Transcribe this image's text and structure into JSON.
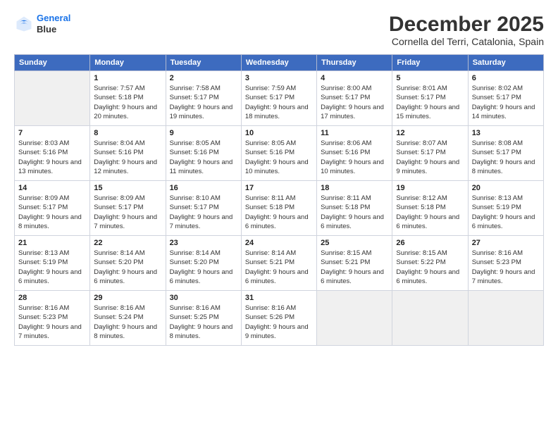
{
  "logo": {
    "line1": "General",
    "line2": "Blue"
  },
  "header": {
    "month": "December 2025",
    "location": "Cornella del Terri, Catalonia, Spain"
  },
  "weekdays": [
    "Sunday",
    "Monday",
    "Tuesday",
    "Wednesday",
    "Thursday",
    "Friday",
    "Saturday"
  ],
  "weeks": [
    [
      {
        "day": "",
        "sunrise": "",
        "sunset": "",
        "daylight": ""
      },
      {
        "day": "1",
        "sunrise": "Sunrise: 7:57 AM",
        "sunset": "Sunset: 5:18 PM",
        "daylight": "Daylight: 9 hours and 20 minutes."
      },
      {
        "day": "2",
        "sunrise": "Sunrise: 7:58 AM",
        "sunset": "Sunset: 5:17 PM",
        "daylight": "Daylight: 9 hours and 19 minutes."
      },
      {
        "day": "3",
        "sunrise": "Sunrise: 7:59 AM",
        "sunset": "Sunset: 5:17 PM",
        "daylight": "Daylight: 9 hours and 18 minutes."
      },
      {
        "day": "4",
        "sunrise": "Sunrise: 8:00 AM",
        "sunset": "Sunset: 5:17 PM",
        "daylight": "Daylight: 9 hours and 17 minutes."
      },
      {
        "day": "5",
        "sunrise": "Sunrise: 8:01 AM",
        "sunset": "Sunset: 5:17 PM",
        "daylight": "Daylight: 9 hours and 15 minutes."
      },
      {
        "day": "6",
        "sunrise": "Sunrise: 8:02 AM",
        "sunset": "Sunset: 5:17 PM",
        "daylight": "Daylight: 9 hours and 14 minutes."
      }
    ],
    [
      {
        "day": "7",
        "sunrise": "Sunrise: 8:03 AM",
        "sunset": "Sunset: 5:16 PM",
        "daylight": "Daylight: 9 hours and 13 minutes."
      },
      {
        "day": "8",
        "sunrise": "Sunrise: 8:04 AM",
        "sunset": "Sunset: 5:16 PM",
        "daylight": "Daylight: 9 hours and 12 minutes."
      },
      {
        "day": "9",
        "sunrise": "Sunrise: 8:05 AM",
        "sunset": "Sunset: 5:16 PM",
        "daylight": "Daylight: 9 hours and 11 minutes."
      },
      {
        "day": "10",
        "sunrise": "Sunrise: 8:05 AM",
        "sunset": "Sunset: 5:16 PM",
        "daylight": "Daylight: 9 hours and 10 minutes."
      },
      {
        "day": "11",
        "sunrise": "Sunrise: 8:06 AM",
        "sunset": "Sunset: 5:16 PM",
        "daylight": "Daylight: 9 hours and 10 minutes."
      },
      {
        "day": "12",
        "sunrise": "Sunrise: 8:07 AM",
        "sunset": "Sunset: 5:17 PM",
        "daylight": "Daylight: 9 hours and 9 minutes."
      },
      {
        "day": "13",
        "sunrise": "Sunrise: 8:08 AM",
        "sunset": "Sunset: 5:17 PM",
        "daylight": "Daylight: 9 hours and 8 minutes."
      }
    ],
    [
      {
        "day": "14",
        "sunrise": "Sunrise: 8:09 AM",
        "sunset": "Sunset: 5:17 PM",
        "daylight": "Daylight: 9 hours and 8 minutes."
      },
      {
        "day": "15",
        "sunrise": "Sunrise: 8:09 AM",
        "sunset": "Sunset: 5:17 PM",
        "daylight": "Daylight: 9 hours and 7 minutes."
      },
      {
        "day": "16",
        "sunrise": "Sunrise: 8:10 AM",
        "sunset": "Sunset: 5:17 PM",
        "daylight": "Daylight: 9 hours and 7 minutes."
      },
      {
        "day": "17",
        "sunrise": "Sunrise: 8:11 AM",
        "sunset": "Sunset: 5:18 PM",
        "daylight": "Daylight: 9 hours and 6 minutes."
      },
      {
        "day": "18",
        "sunrise": "Sunrise: 8:11 AM",
        "sunset": "Sunset: 5:18 PM",
        "daylight": "Daylight: 9 hours and 6 minutes."
      },
      {
        "day": "19",
        "sunrise": "Sunrise: 8:12 AM",
        "sunset": "Sunset: 5:18 PM",
        "daylight": "Daylight: 9 hours and 6 minutes."
      },
      {
        "day": "20",
        "sunrise": "Sunrise: 8:13 AM",
        "sunset": "Sunset: 5:19 PM",
        "daylight": "Daylight: 9 hours and 6 minutes."
      }
    ],
    [
      {
        "day": "21",
        "sunrise": "Sunrise: 8:13 AM",
        "sunset": "Sunset: 5:19 PM",
        "daylight": "Daylight: 9 hours and 6 minutes."
      },
      {
        "day": "22",
        "sunrise": "Sunrise: 8:14 AM",
        "sunset": "Sunset: 5:20 PM",
        "daylight": "Daylight: 9 hours and 6 minutes."
      },
      {
        "day": "23",
        "sunrise": "Sunrise: 8:14 AM",
        "sunset": "Sunset: 5:20 PM",
        "daylight": "Daylight: 9 hours and 6 minutes."
      },
      {
        "day": "24",
        "sunrise": "Sunrise: 8:14 AM",
        "sunset": "Sunset: 5:21 PM",
        "daylight": "Daylight: 9 hours and 6 minutes."
      },
      {
        "day": "25",
        "sunrise": "Sunrise: 8:15 AM",
        "sunset": "Sunset: 5:21 PM",
        "daylight": "Daylight: 9 hours and 6 minutes."
      },
      {
        "day": "26",
        "sunrise": "Sunrise: 8:15 AM",
        "sunset": "Sunset: 5:22 PM",
        "daylight": "Daylight: 9 hours and 6 minutes."
      },
      {
        "day": "27",
        "sunrise": "Sunrise: 8:16 AM",
        "sunset": "Sunset: 5:23 PM",
        "daylight": "Daylight: 9 hours and 7 minutes."
      }
    ],
    [
      {
        "day": "28",
        "sunrise": "Sunrise: 8:16 AM",
        "sunset": "Sunset: 5:23 PM",
        "daylight": "Daylight: 9 hours and 7 minutes."
      },
      {
        "day": "29",
        "sunrise": "Sunrise: 8:16 AM",
        "sunset": "Sunset: 5:24 PM",
        "daylight": "Daylight: 9 hours and 8 minutes."
      },
      {
        "day": "30",
        "sunrise": "Sunrise: 8:16 AM",
        "sunset": "Sunset: 5:25 PM",
        "daylight": "Daylight: 9 hours and 8 minutes."
      },
      {
        "day": "31",
        "sunrise": "Sunrise: 8:16 AM",
        "sunset": "Sunset: 5:26 PM",
        "daylight": "Daylight: 9 hours and 9 minutes."
      },
      {
        "day": "",
        "sunrise": "",
        "sunset": "",
        "daylight": ""
      },
      {
        "day": "",
        "sunrise": "",
        "sunset": "",
        "daylight": ""
      },
      {
        "day": "",
        "sunrise": "",
        "sunset": "",
        "daylight": ""
      }
    ]
  ]
}
